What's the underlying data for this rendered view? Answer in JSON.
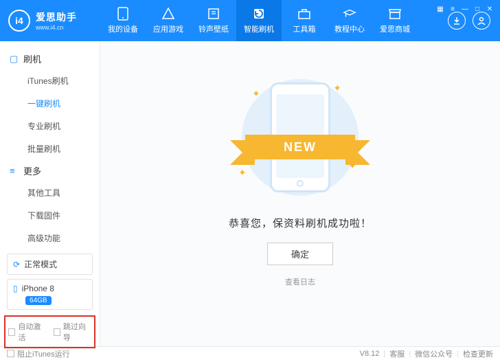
{
  "brand": {
    "name": "爱思助手",
    "domain": "www.i4.cn",
    "logo": "i4"
  },
  "nav": [
    {
      "label": "我的设备"
    },
    {
      "label": "应用游戏"
    },
    {
      "label": "铃声壁纸"
    },
    {
      "label": "智能刷机"
    },
    {
      "label": "工具箱"
    },
    {
      "label": "教程中心"
    },
    {
      "label": "爱思商城"
    }
  ],
  "sidebar": {
    "section1": {
      "title": "刷机",
      "items": [
        "iTunes刷机",
        "一键刷机",
        "专业刷机",
        "批量刷机"
      ]
    },
    "section2": {
      "title": "更多",
      "items": [
        "其他工具",
        "下载固件",
        "高级功能"
      ]
    },
    "status": "正常模式",
    "device": {
      "name": "iPhone 8",
      "storage": "64GB"
    },
    "checks": {
      "auto": "自动激活",
      "skip": "跳过向导"
    }
  },
  "main": {
    "ribbon": "NEW",
    "message": "恭喜您，保资料刷机成功啦！",
    "ok": "确定",
    "log": "查看日志"
  },
  "footer": {
    "block": "阻止iTunes运行",
    "version": "V8.12",
    "service": "客服",
    "wechat": "微信公众号",
    "update": "检查更新"
  }
}
